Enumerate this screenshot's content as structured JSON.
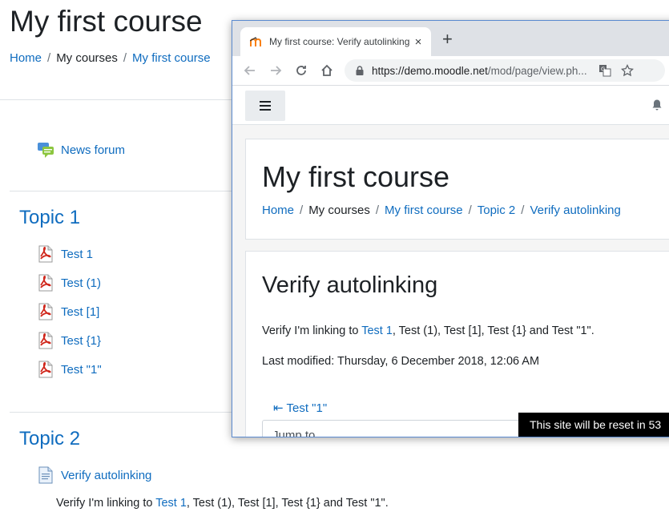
{
  "course": {
    "title": "My first course",
    "breadcrumb": {
      "home": "Home",
      "my_courses": "My courses",
      "course": "My first course",
      "sep": "/"
    },
    "news_forum": "News forum",
    "topic1": {
      "title": "Topic 1",
      "files": [
        "Test 1",
        "Test (1)",
        "Test [1]",
        "Test {1}",
        "Test \"1\""
      ]
    },
    "topic2": {
      "title": "Topic 2",
      "page_link": "Verify autolinking",
      "summary_before": "Verify I'm linking to ",
      "summary_link": "Test 1",
      "summary_after": ", Test (1), Test [1], Test {1} and Test \"1\"."
    }
  },
  "browser": {
    "tab_title": "My first course: Verify autolinking",
    "new_tab": "+",
    "close": "×",
    "url_host": "https://demo.moodle.net",
    "url_path": "/mod/page/view.ph...",
    "page": {
      "course_title": "My first course",
      "breadcrumb": {
        "home": "Home",
        "my_courses": "My courses",
        "course": "My first course",
        "topic": "Topic 2",
        "page": "Verify autolinking",
        "sep": "/"
      },
      "heading": "Verify autolinking",
      "body_before": "Verify I'm linking to ",
      "body_link": "Test 1",
      "body_after": ", Test (1), Test [1], Test {1} and Test \"1\".",
      "last_modified": "Last modified: Thursday, 6 December 2018, 12:06 AM",
      "prev_arrow": "⇤",
      "prev_activity": "Test \"1\"",
      "jump_to": "Jump to..."
    }
  },
  "toast": "This site will be reset in 53",
  "colors": {
    "link": "#0f6cbf",
    "pdf_red": "#d0271c",
    "window_border": "#5b8bd0"
  }
}
